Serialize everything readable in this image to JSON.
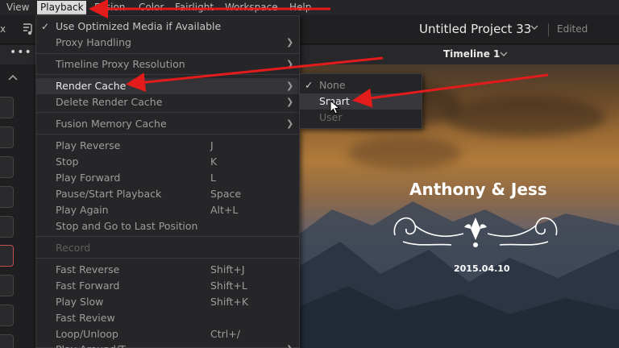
{
  "menubar": {
    "items": [
      "View",
      "Playback",
      "Fusion",
      "Color",
      "Fairlight",
      "Workspace",
      "Help"
    ],
    "active": "Playback"
  },
  "header": {
    "project_title": "Untitled Project 33",
    "status": "Edited"
  },
  "timeline_bar": {
    "timeline_name": "Timeline 1"
  },
  "playback_menu": {
    "use_optimized": "Use Optimized Media if Available",
    "proxy_handling": "Proxy Handling",
    "timeline_proxy_resolution": "Timeline Proxy Resolution",
    "render_cache": "Render Cache",
    "delete_render_cache": "Delete Render Cache",
    "fusion_memory_cache": "Fusion Memory Cache",
    "transport": [
      {
        "label": "Play Reverse",
        "shortcut": "J"
      },
      {
        "label": "Stop",
        "shortcut": "K"
      },
      {
        "label": "Play Forward",
        "shortcut": "L"
      },
      {
        "label": "Pause/Start Playback",
        "shortcut": "Space"
      },
      {
        "label": "Play Again",
        "shortcut": "Alt+L"
      },
      {
        "label": "Stop and Go to Last Position",
        "shortcut": ""
      }
    ],
    "record": "Record",
    "speed": [
      {
        "label": "Fast Reverse",
        "shortcut": "Shift+J"
      },
      {
        "label": "Fast Forward",
        "shortcut": "Shift+L"
      },
      {
        "label": "Play Slow",
        "shortcut": "Shift+K"
      },
      {
        "label": "Fast Review",
        "shortcut": ""
      },
      {
        "label": "Loop/Unloop",
        "shortcut": "Ctrl+/"
      },
      {
        "label": "Play Around/T",
        "shortcut": ""
      }
    ]
  },
  "render_cache_submenu": {
    "options": [
      "None",
      "Smart",
      "User"
    ],
    "checked": "None",
    "hovered": "Smart"
  },
  "viewer": {
    "title_text": "Anthony & Jess",
    "date_text": "2015.04.10"
  },
  "colors": {
    "annotation_arrow": "#e41b1b",
    "menu_bg": "#262629",
    "highlight_bg": "#343438"
  }
}
